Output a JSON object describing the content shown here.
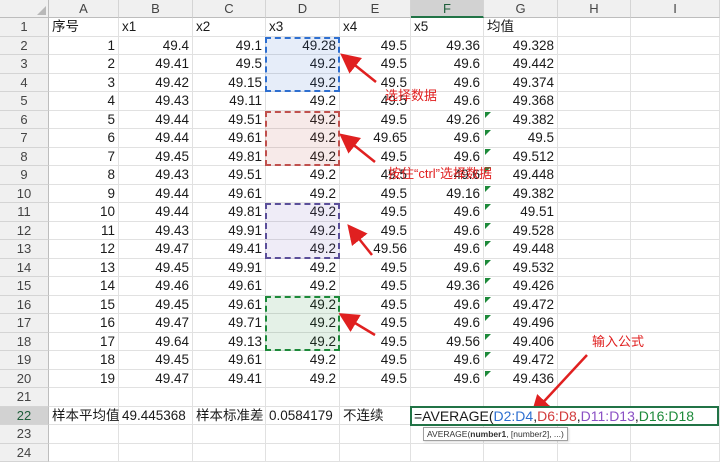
{
  "columns": [
    "A",
    "B",
    "C",
    "D",
    "E",
    "F",
    "G",
    "H",
    "I"
  ],
  "selected_column": "F",
  "selected_row": "22",
  "header_row": [
    "序号",
    "x1",
    "x2",
    "x3",
    "x4",
    "x5",
    "均值"
  ],
  "rows": [
    [
      "1",
      "49.4",
      "49.1",
      "49.28",
      "49.5",
      "49.36",
      "49.328"
    ],
    [
      "2",
      "49.41",
      "49.5",
      "49.2",
      "49.5",
      "49.6",
      "49.442"
    ],
    [
      "3",
      "49.42",
      "49.15",
      "49.2",
      "49.5",
      "49.6",
      "49.374"
    ],
    [
      "4",
      "49.43",
      "49.11",
      "49.2",
      "49.5",
      "49.6",
      "49.368"
    ],
    [
      "5",
      "49.44",
      "49.51",
      "49.2",
      "49.5",
      "49.26",
      "49.382"
    ],
    [
      "6",
      "49.44",
      "49.61",
      "49.2",
      "49.65",
      "49.6",
      "49.5"
    ],
    [
      "7",
      "49.45",
      "49.81",
      "49.2",
      "49.5",
      "49.6",
      "49.512"
    ],
    [
      "8",
      "49.43",
      "49.51",
      "49.2",
      "49.5",
      "49.6",
      "49.448"
    ],
    [
      "9",
      "49.44",
      "49.61",
      "49.2",
      "49.5",
      "49.16",
      "49.382"
    ],
    [
      "10",
      "49.44",
      "49.81",
      "49.2",
      "49.5",
      "49.6",
      "49.51"
    ],
    [
      "11",
      "49.43",
      "49.91",
      "49.2",
      "49.5",
      "49.6",
      "49.528"
    ],
    [
      "12",
      "49.47",
      "49.41",
      "49.2",
      "49.56",
      "49.6",
      "49.448"
    ],
    [
      "13",
      "49.45",
      "49.91",
      "49.2",
      "49.5",
      "49.6",
      "49.532"
    ],
    [
      "14",
      "49.46",
      "49.61",
      "49.2",
      "49.5",
      "49.36",
      "49.426"
    ],
    [
      "15",
      "49.45",
      "49.61",
      "49.2",
      "49.5",
      "49.6",
      "49.472"
    ],
    [
      "16",
      "49.47",
      "49.71",
      "49.2",
      "49.5",
      "49.6",
      "49.496"
    ],
    [
      "17",
      "49.64",
      "49.13",
      "49.2",
      "49.5",
      "49.56",
      "49.406"
    ],
    [
      "18",
      "49.45",
      "49.61",
      "49.2",
      "49.5",
      "49.6",
      "49.472"
    ],
    [
      "19",
      "49.47",
      "49.41",
      "49.2",
      "49.5",
      "49.6",
      "49.436"
    ]
  ],
  "row22": {
    "a": "样本平均值",
    "b": "49.445368",
    "c": "样本标准差",
    "d": "0.0584179",
    "e": "不连续"
  },
  "formula": {
    "prefix": "=AVERAGE(",
    "args": [
      {
        "text": "D2:D4",
        "color": "#2e6fd0"
      },
      {
        "text": ",",
        "color": "#1a1a1a"
      },
      {
        "text": "D6:D8",
        "color": "#d23c3c"
      },
      {
        "text": ",",
        "color": "#1a1a1a"
      },
      {
        "text": "D11:D13",
        "color": "#8a4fc4"
      },
      {
        "text": ",",
        "color": "#1a1a1a"
      },
      {
        "text": "D16:D18",
        "color": "#1d8a3a"
      }
    ]
  },
  "tooltip": {
    "func": "AVERAGE(",
    "arg1": "number1",
    "rest": ", [number2], ...)"
  },
  "annotations": {
    "select_data": "选择数据",
    "ctrl_select": "按住“ctrl”选择数据",
    "enter_formula": "输入公式"
  },
  "colors": {
    "range1": "#2e6fd0",
    "range2": "#c0504d",
    "range3": "#5b4f9a",
    "range4": "#1d8a3a",
    "arrow": "#e02020"
  }
}
